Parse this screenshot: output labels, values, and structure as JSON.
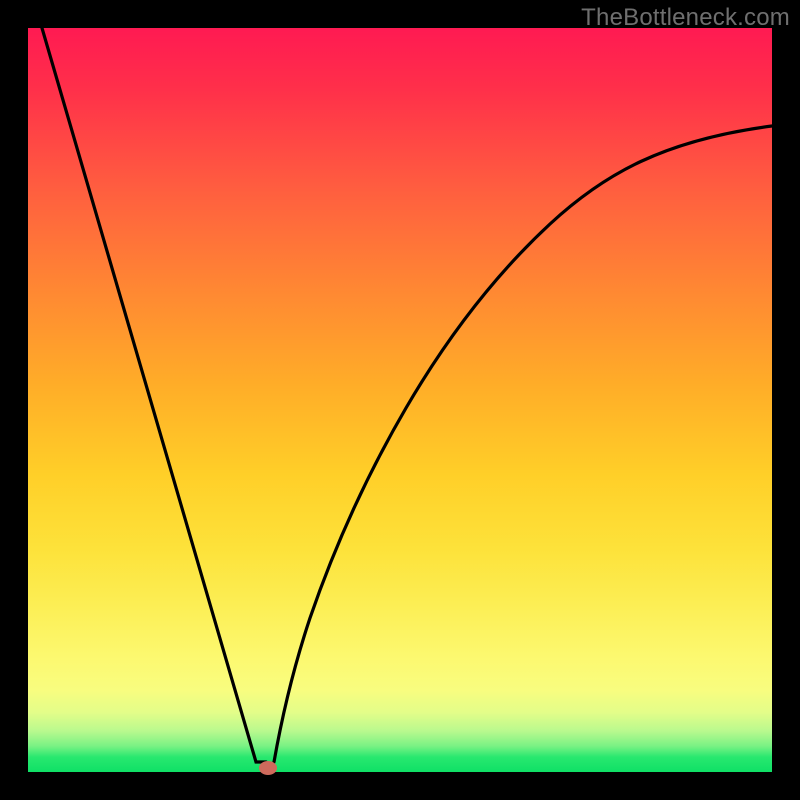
{
  "watermark": "TheBottleneck.com",
  "colors": {
    "frame": "#000000",
    "curve": "#000000",
    "marker": "#cf6a5c",
    "gradient_top": "#ff1a52",
    "gradient_bottom": "#0fe066"
  },
  "chart_data": {
    "type": "line",
    "title": "",
    "xlabel": "",
    "ylabel": "",
    "xlim": [
      0,
      100
    ],
    "ylim": [
      0,
      100
    ],
    "grid": false,
    "legend": false,
    "series": [
      {
        "name": "left-branch",
        "x": [
          2,
          7,
          12,
          17,
          22,
          26,
          29,
          30.5,
          31.5
        ],
        "y": [
          100,
          82,
          64,
          46,
          28,
          14,
          4,
          1.5,
          1.5
        ]
      },
      {
        "name": "right-branch",
        "x": [
          33,
          35,
          38,
          42,
          47,
          53,
          60,
          68,
          77,
          88,
          100
        ],
        "y": [
          1.5,
          8,
          20,
          34,
          48,
          59,
          68,
          75,
          80.5,
          84.5,
          87
        ]
      }
    ],
    "annotations": [
      {
        "name": "minimum-marker",
        "x": 32,
        "y": 0.5
      }
    ]
  }
}
